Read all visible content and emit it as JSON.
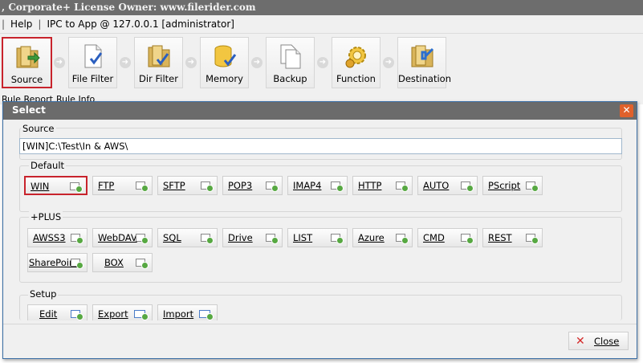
{
  "titlebar": {
    "text": ", Corporate+ License Owner: www.filerider.com"
  },
  "menubar": {
    "help": "Help",
    "ipc": "IPC to App @ 127.0.0.1 [administrator]"
  },
  "toolbar": {
    "items": [
      {
        "label": "Source",
        "icon": "folder-arrow-icon"
      },
      {
        "label": "File Filter",
        "icon": "file-check-icon"
      },
      {
        "label": "Dir Filter",
        "icon": "folder-check-icon"
      },
      {
        "label": "Memory",
        "icon": "database-check-icon"
      },
      {
        "label": "Backup",
        "icon": "copy-icon"
      },
      {
        "label": "Function",
        "icon": "gear-icon"
      },
      {
        "label": "Destination",
        "icon": "folder-arrow-in-icon"
      }
    ]
  },
  "tabs": {
    "rule_report": "Rule Report",
    "rule_info": "Rule Info"
  },
  "dialog": {
    "title": "Select",
    "source_label": "Source",
    "source_value": "[WIN]C:\\Test\\In & AWS\\",
    "default_label": "Default",
    "default_buttons": [
      "WIN",
      "FTP",
      "SFTP",
      "POP3",
      "IMAP4",
      "HTTP",
      "AUTO",
      "PScript"
    ],
    "plus_label": "+PLUS",
    "plus_buttons": [
      "AWSS3",
      "WebDAV",
      "SQL",
      "Drive",
      "LIST",
      "Azure",
      "CMD",
      "REST",
      "SharePoint",
      "BOX"
    ],
    "setup_label": "Setup",
    "setup_buttons": [
      "Edit",
      "Export",
      "Import"
    ],
    "close_label": "Close"
  },
  "colors": {
    "accent_red": "#c8232c",
    "dialog_header": "#6b6b6b",
    "close_orange": "#e0612b"
  }
}
